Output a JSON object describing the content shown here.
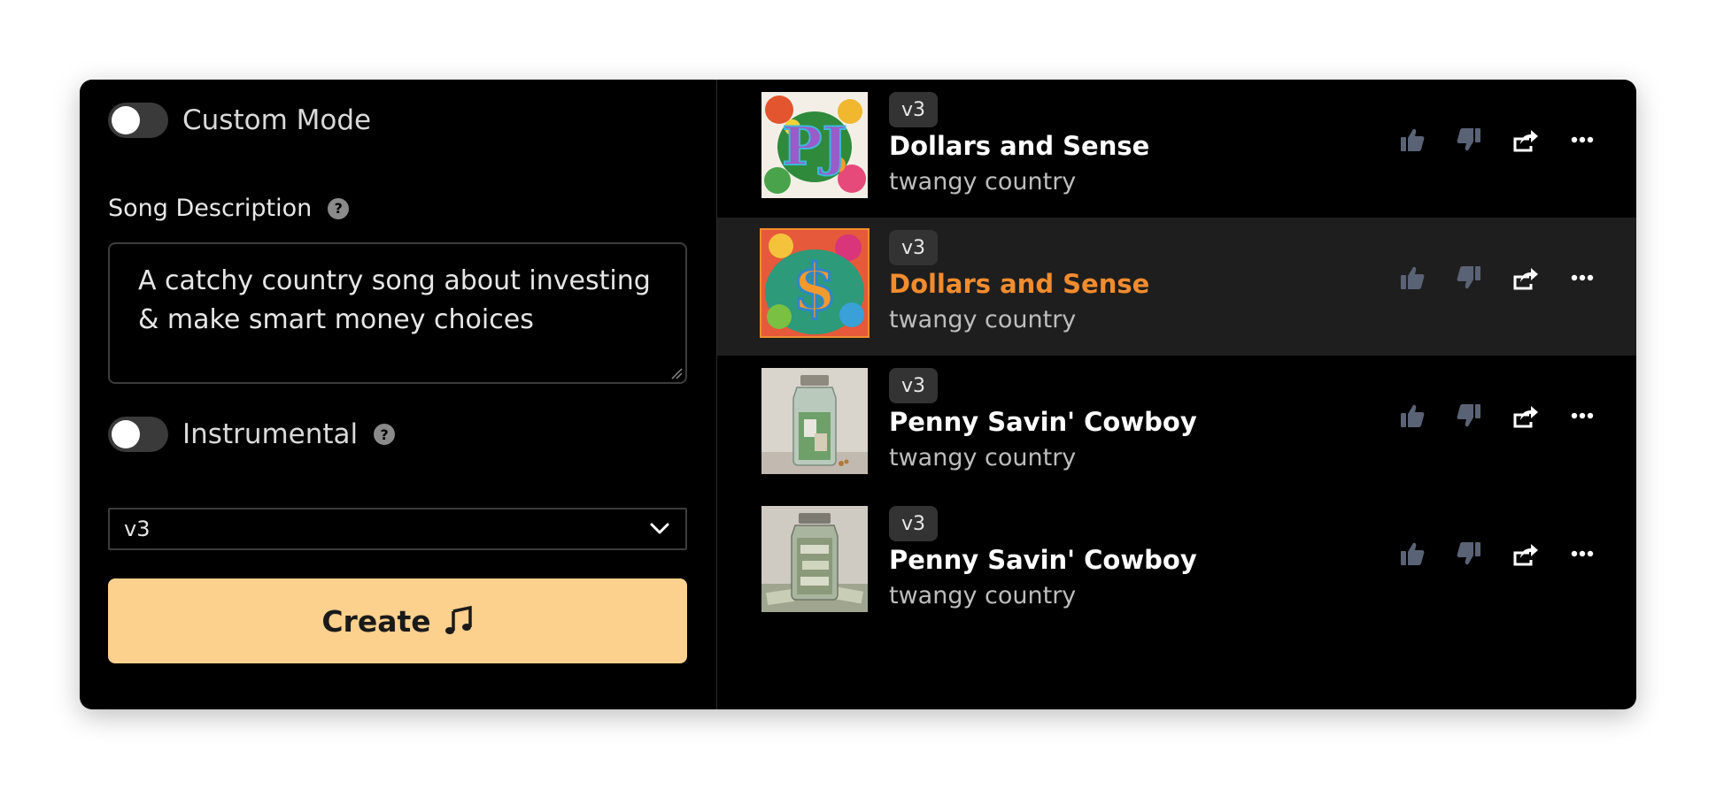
{
  "form": {
    "custom_mode_label": "Custom Mode",
    "song_description_label": "Song Description",
    "help_glyph": "?",
    "song_description_value": "A catchy country song about investing & make smart money choices",
    "instrumental_label": "Instrumental",
    "model_select_value": "v3",
    "create_label": "Create"
  },
  "songs": [
    {
      "version": "v3",
      "title": "Dollars and Sense",
      "style": "twangy country",
      "active": false
    },
    {
      "version": "v3",
      "title": "Dollars and Sense",
      "style": "twangy country",
      "active": true
    },
    {
      "version": "v3",
      "title": "Penny Savin' Cowboy",
      "style": "twangy country",
      "active": false
    },
    {
      "version": "v3",
      "title": "Penny Savin' Cowboy",
      "style": "twangy country",
      "active": false
    }
  ],
  "colors": {
    "accent": "#f28c2e",
    "create_button": "#fcd08d",
    "panel_bg": "#000000",
    "active_row_bg": "#1e1e1e",
    "action_icon": "#5a6275"
  },
  "icons": [
    "help-icon",
    "chevron-down-icon",
    "music-note-icon",
    "thumbs-up-icon",
    "thumbs-down-icon",
    "share-icon",
    "more-icon"
  ]
}
